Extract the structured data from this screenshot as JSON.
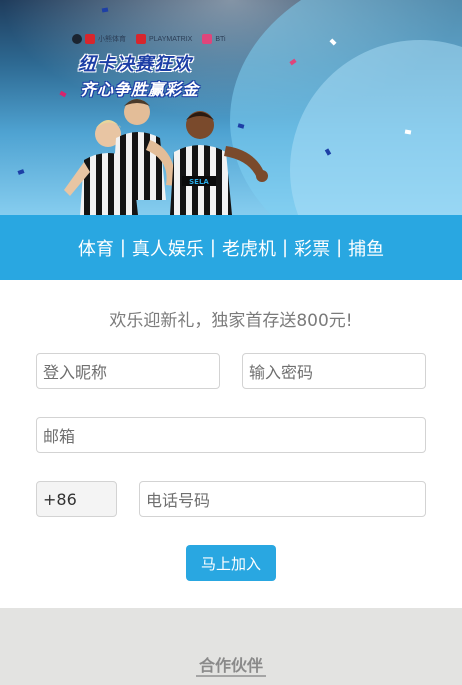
{
  "banner": {
    "logos": [
      "小熊体育",
      "PLAYMATRIX",
      "BTi"
    ],
    "headline_line1": "纽卡决赛狂欢",
    "headline_line2": "齐心争胜赢彩金",
    "jersey_sponsor": "SELA"
  },
  "nav": {
    "items": [
      "体育",
      "真人娱乐",
      "老虎机",
      "彩票",
      "捕鱼"
    ],
    "separator": "|"
  },
  "form": {
    "welcome": "欢乐迎新礼，独家首存送800元!",
    "nickname_placeholder": "登入昵称",
    "password_placeholder": "输入密码",
    "email_placeholder": "邮箱",
    "country_code": "+86",
    "phone_placeholder": "电话号码",
    "submit_label": "马上加入"
  },
  "partners": {
    "title": "合作伙伴"
  },
  "colors": {
    "accent": "#29a7e1",
    "partners_bg": "#e3e3e1"
  }
}
